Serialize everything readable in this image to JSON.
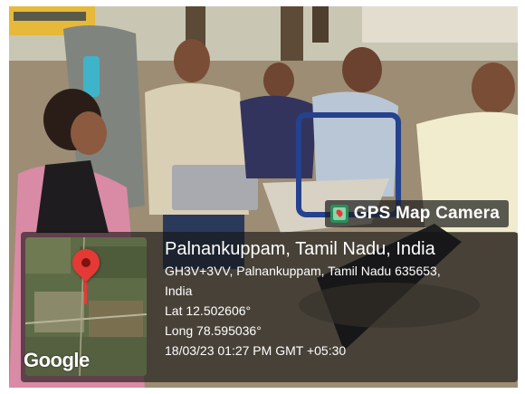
{
  "gps_camera": {
    "app_label": "GPS Map Camera",
    "place": "Palnankuppam, Tamil Nadu, India",
    "address_line1": "GH3V+3VV, Palnankuppam, Tamil Nadu 635653,",
    "address_line2": "India",
    "latitude": "Lat 12.502606°",
    "longitude": "Long 78.595036°",
    "datetime": "18/03/23 01:27 PM GMT +05:30",
    "map_provider": "Google",
    "icon": "gps-map-camera-icon"
  },
  "scene": {
    "description_items": [
      "people-seated-on-plastic-chairs",
      "laptop",
      "trees",
      "school-bus",
      "stacked-chairs"
    ]
  }
}
